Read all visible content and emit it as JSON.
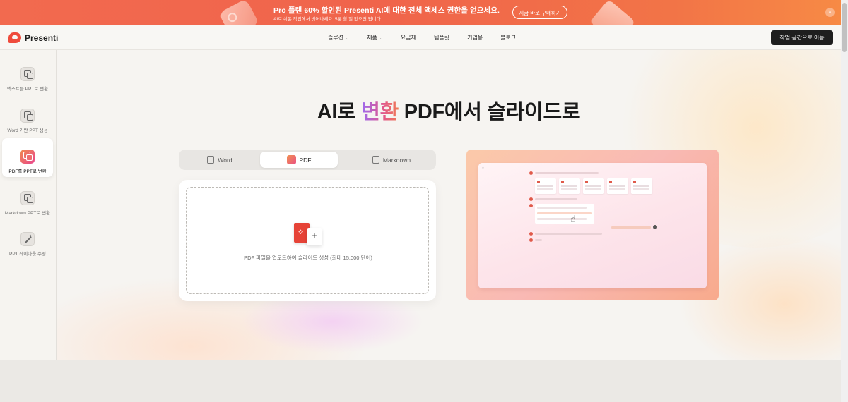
{
  "promo": {
    "title": "Pro 플랜 60% 할인된 Presenti AI에 대한 전체 액세스 권한을 얻으세요.",
    "subtitle": "AI로 쉬운 작업에서 벗어나세요. 5분 할 일 없으면 됩니다.",
    "cta": "지금 바로 구매하기",
    "close": "×"
  },
  "nav": {
    "logo": "Presenti",
    "menu": [
      {
        "label": "솔루션",
        "chevron": "⌄"
      },
      {
        "label": "제품",
        "chevron": "⌄"
      },
      {
        "label": "요금제"
      },
      {
        "label": "템플릿"
      },
      {
        "label": "기업용"
      },
      {
        "label": "블로그"
      }
    ],
    "workspace_button": "작업 공간으로 이동"
  },
  "sidebar": {
    "items": [
      {
        "label": "텍스트를 PPT로 변환",
        "icon": "text-to-ppt-icon"
      },
      {
        "label": "Word 기반 PPT 생성",
        "icon": "word-to-ppt-icon"
      },
      {
        "label": "PDF를 PPT로 변환",
        "icon": "pdf-to-ppt-icon",
        "active": true
      },
      {
        "label": "Markdown PPT로 변환",
        "icon": "markdown-to-ppt-icon"
      },
      {
        "label": "PPT 레이아웃 수정",
        "icon": "magic-wand-icon"
      }
    ]
  },
  "main": {
    "headline_pre": "AI로 ",
    "headline_highlight": "변환",
    "headline_post": " PDF에서 슬라이드로",
    "tabs": [
      {
        "label": "Word",
        "icon": "word-file-icon"
      },
      {
        "label": "PDF",
        "icon": "pdf-file-icon",
        "active": true
      },
      {
        "label": "Markdown",
        "icon": "markdown-file-icon"
      }
    ],
    "upload_text": "PDF 파일을 업로드하여 슬라이드 생성 (최대 15,000 단어)",
    "upload_plus": "+"
  },
  "colors": {
    "brand_red": "#ef4b3c",
    "promo_bg": "#f26a4f",
    "accent_gradient_start": "#9b6af2",
    "accent_gradient_end": "#f07a55"
  }
}
